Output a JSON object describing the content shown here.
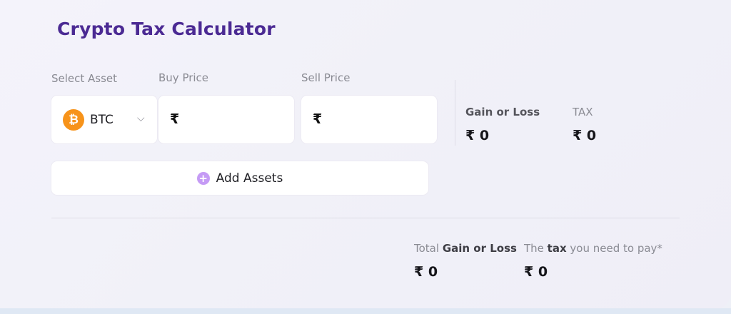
{
  "title": "Crypto Tax Calculator",
  "labels": {
    "select_asset": "Select Asset",
    "buy_price": "Buy Price",
    "sell_price": "Sell Price"
  },
  "asset": {
    "icon": "bitcoin-icon",
    "symbol_glyph": "₿",
    "selected": "BTC",
    "chevron": "⌵"
  },
  "buy_price": {
    "currency": "₹",
    "value": ""
  },
  "sell_price": {
    "currency": "₹",
    "value": ""
  },
  "summary": {
    "gain_label": "Gain or Loss",
    "gain_value": "₹ 0",
    "tax_label": "TAX",
    "tax_value": "₹ 0"
  },
  "add_button": {
    "icon": "plus-circle-icon",
    "glyph": "+",
    "label": "Add Assets"
  },
  "totals": {
    "total_prefix": "Total ",
    "total_bold": "Gain or Loss",
    "total_value": "₹ 0",
    "tax_prefix": "The ",
    "tax_bold": "tax",
    "tax_suffix": " you need to pay*",
    "tax_value": "₹ 0"
  },
  "colors": {
    "title": "#4b2a93",
    "bitcoin": "#f7931a",
    "plus_icon": "#c59bf5"
  }
}
